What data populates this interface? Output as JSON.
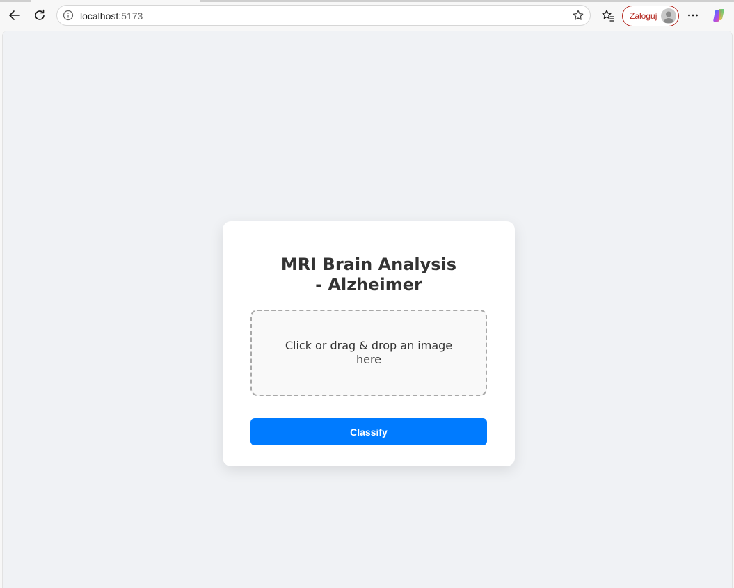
{
  "browser": {
    "url_host": "localhost",
    "url_port": ":5173",
    "signin_label": "Zaloguj",
    "icons": {
      "back": "back-arrow-icon",
      "refresh": "refresh-icon",
      "info": "info-icon",
      "star": "star-icon",
      "favorites": "favorites-icon",
      "more": "more-icon",
      "copilot": "copilot-icon"
    }
  },
  "page": {
    "title": "MRI Brain Analysis - Alzheimer",
    "dropzone_text": "Click or drag & drop an image here",
    "classify_label": "Classify",
    "colors": {
      "background": "#f0f2f5",
      "card": "#ffffff",
      "accent": "#007bff",
      "text": "#333333"
    }
  }
}
